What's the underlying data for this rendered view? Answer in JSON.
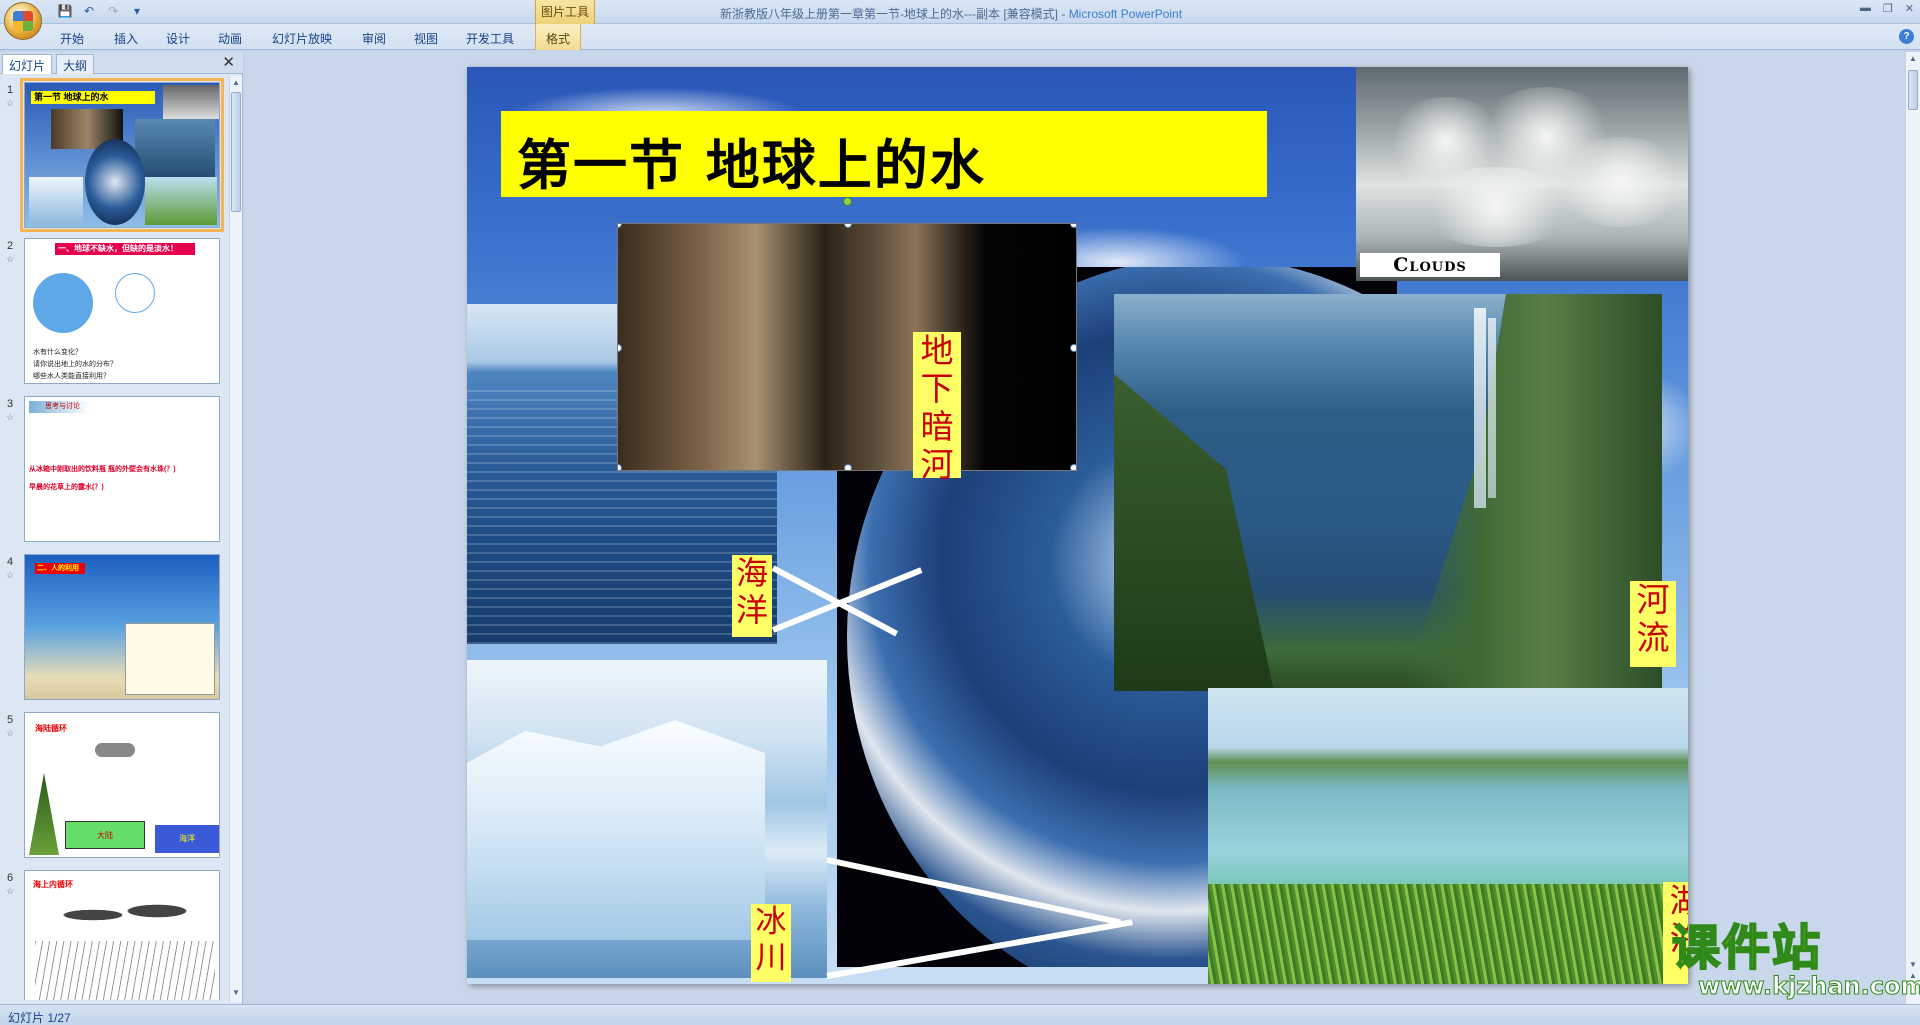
{
  "title_bar": {
    "document_title": "新浙教版八年级上册第一章第一节-地球上的水---副本 [兼容模式]",
    "app_name": "Microsoft PowerPoint",
    "context_group": "图片工具"
  },
  "quick_access": [
    "save-icon",
    "undo-icon",
    "redo-icon",
    "customize-icon"
  ],
  "ribbon": {
    "tabs": [
      "开始",
      "插入",
      "设计",
      "动画",
      "幻灯片放映",
      "审阅",
      "视图",
      "开发工具",
      "格式"
    ]
  },
  "left_panel": {
    "tab_slides": "幻灯片",
    "tab_outline": "大纲",
    "thumbnails": [
      {
        "num": "1",
        "heading": "第一节  地球上的水"
      },
      {
        "num": "2",
        "heading": "一、地球不缺水，但缺的是淡水！",
        "lines": [
          "水有什么变化？",
          "请你说出地上的水的分布？",
          "哪些水人类能直接利用？"
        ]
      },
      {
        "num": "3",
        "heading": "思考与讨论",
        "lines": [
          "从冰箱中刚取出的饮料瓶  瓶的外壁会有水珠(？)",
          "早晨的花草上的露水(？)"
        ]
      },
      {
        "num": "4",
        "heading": "二、人的利用"
      },
      {
        "num": "5",
        "heading": "海陆循环",
        "lines": [
          "大陆",
          "海洋"
        ]
      },
      {
        "num": "6",
        "heading": "海上内循环"
      }
    ]
  },
  "slide": {
    "title": "第一节   地球上的水",
    "clouds_caption": "Clouds",
    "labels": {
      "underground": "地下暗河",
      "ocean": "海洋",
      "river": "河流",
      "glacier": "冰川",
      "lake": "湖泊"
    }
  },
  "watermark": {
    "main": "课件站",
    "url": "www.kjzhan.com"
  },
  "status_bar": {
    "slide_info": "幻灯片 1/27"
  },
  "colors": {
    "title_highlight": "#ffff00",
    "label_bg": "#ffff66",
    "label_text": "#cc0000",
    "selection": "#f4b453"
  }
}
